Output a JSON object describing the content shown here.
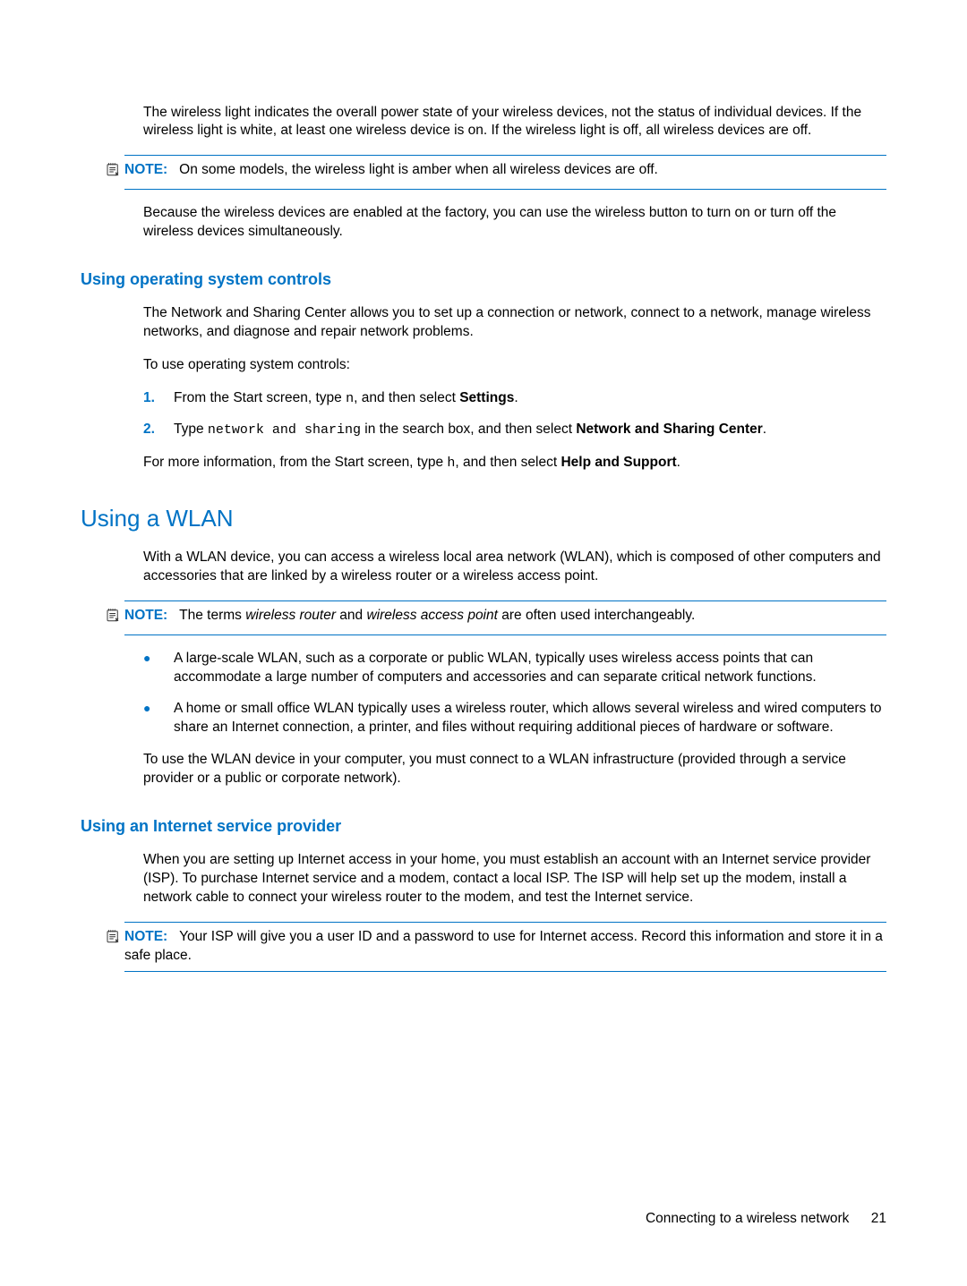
{
  "intro_p1": "The wireless light indicates the overall power state of your wireless devices, not the status of individual devices. If the wireless light is white, at least one wireless device is on. If the wireless light is off, all wireless devices are off.",
  "note1": {
    "label": "NOTE:",
    "text": "On some models, the wireless light is amber when all wireless devices are off."
  },
  "intro_p2": "Because the wireless devices are enabled at the factory, you can use the wireless button to turn on or turn off the wireless devices simultaneously.",
  "section_os": {
    "title": "Using operating system controls",
    "p1": "The Network and Sharing Center allows you to set up a connection or network, connect to a network, manage wireless networks, and diagnose and repair network problems.",
    "p2": "To use operating system controls:",
    "steps": {
      "1": {
        "pre": "From the Start screen, type ",
        "code": "n",
        "mid": ", and then select ",
        "bold": "Settings",
        "post": "."
      },
      "2": {
        "pre": "Type ",
        "code": "network and sharing",
        "mid1": " in the search box, and then select ",
        "bold": "Network and Sharing Center",
        "post": "."
      }
    },
    "p3_pre": "For more information, from the Start screen, type ",
    "p3_code": "h",
    "p3_mid": ", and then select ",
    "p3_bold": "Help and Support",
    "p3_post": "."
  },
  "section_wlan": {
    "title": "Using a WLAN",
    "p1": "With a WLAN device, you can access a wireless local area network (WLAN), which is composed of other computers and accessories that are linked by a wireless router or a wireless access point.",
    "note": {
      "label": "NOTE:",
      "pre": "The terms ",
      "i1": "wireless router",
      "mid": " and ",
      "i2": "wireless access point",
      "post": " are often used interchangeably."
    },
    "bullets": {
      "0": "A large-scale WLAN, such as a corporate or public WLAN, typically uses wireless access points that can accommodate a large number of computers and accessories and can separate critical network functions.",
      "1": "A home or small office WLAN typically uses a wireless router, which allows several wireless and wired computers to share an Internet connection, a printer, and files without requiring additional pieces of hardware or software."
    },
    "p2": "To use the WLAN device in your computer, you must connect to a WLAN infrastructure (provided through a service provider or a public or corporate network)."
  },
  "section_isp": {
    "title": "Using an Internet service provider",
    "p1": "When you are setting up Internet access in your home, you must establish an account with an Internet service provider (ISP). To purchase Internet service and a modem, contact a local ISP. The ISP will help set up the modem, install a network cable to connect your wireless router to the modem, and test the Internet service.",
    "note": {
      "label": "NOTE:",
      "text": "Your ISP will give you a user ID and a password to use for Internet access. Record this information and store it in a safe place."
    }
  },
  "footer": {
    "section": "Connecting to a wireless network",
    "page": "21"
  }
}
